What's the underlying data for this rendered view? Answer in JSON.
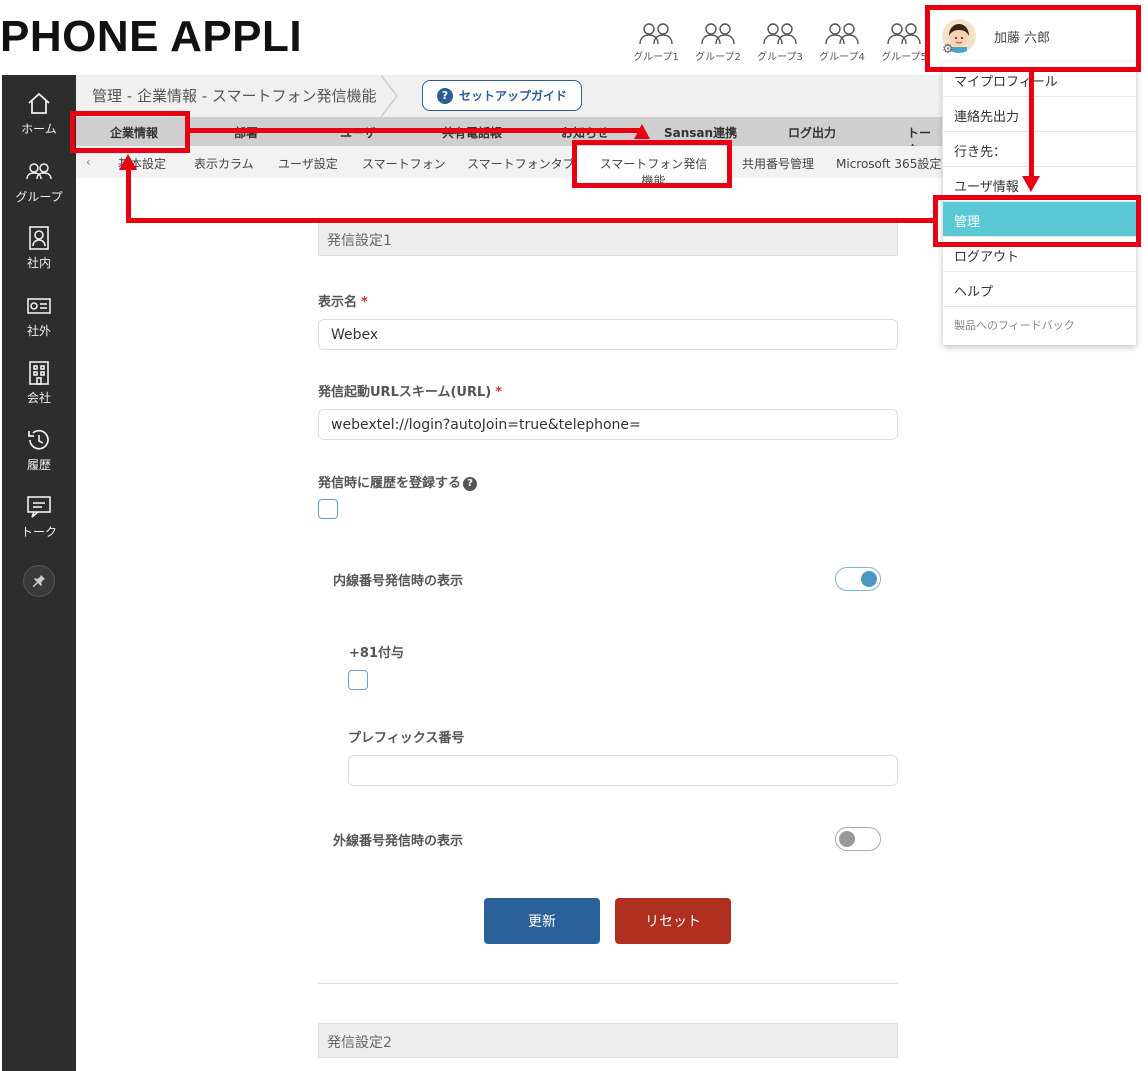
{
  "header": {
    "logo": "PHONE APPLI",
    "groups": [
      "グループ1",
      "グループ2",
      "グループ3",
      "グループ4",
      "グループ5"
    ],
    "user_name": "加藤 六郎"
  },
  "sidebar": {
    "items": [
      {
        "label": "ホーム",
        "icon": "home-icon"
      },
      {
        "label": "グループ",
        "icon": "group-icon"
      },
      {
        "label": "社内",
        "icon": "contact-card-icon"
      },
      {
        "label": "社外",
        "icon": "business-card-icon"
      },
      {
        "label": "会社",
        "icon": "building-icon"
      },
      {
        "label": "履歴",
        "icon": "history-icon"
      },
      {
        "label": "トーク",
        "icon": "chat-icon"
      }
    ]
  },
  "breadcrumb": {
    "path": "管理 - 企業情報 - スマートフォン発信機能",
    "setup_guide": "セットアップガイド"
  },
  "tabs_main": [
    "企業情報",
    "部署",
    "ユーザ",
    "共有電話帳",
    "お知らせ",
    "Sansan連携",
    "ログ出力",
    "トーク"
  ],
  "tabs_sub": [
    "基本設定",
    "表示カラム",
    "ユーザ設定",
    "スマートフォン",
    "スマートフォンタブ",
    "スマートフォン発信機能",
    "共用番号管理",
    "Microsoft 365設定"
  ],
  "tabs_sub_prev": "‹",
  "form": {
    "section1": "発信設定1",
    "display_name_label": "表示名",
    "display_name_value": "Webex",
    "url_scheme_label": "発信起動URLスキーム(URL)",
    "url_scheme_value": "webextel://login?autoJoin=true&telephone=",
    "register_history_label": "発信時に履歴を登録する",
    "register_history_checked": false,
    "internal_display_label": "内線番号発信時の表示",
    "internal_display_on": true,
    "plus81_label": "+81付与",
    "plus81_checked": false,
    "prefix_label": "プレフィックス番号",
    "prefix_value": "",
    "external_display_label": "外線番号発信時の表示",
    "external_display_on": false,
    "update_button": "更新",
    "reset_button": "リセット",
    "section2": "発信設定2",
    "required_mark": "*"
  },
  "dropdown": {
    "items": [
      "マイプロフィール",
      "連絡先出力",
      "行き先：",
      "ユーザ情報",
      "管理",
      "ログアウト",
      "ヘルプ",
      "製品へのフィードバック"
    ],
    "active": "管理"
  },
  "colors": {
    "sidebar_bg": "#2d2d2d",
    "primary_button": "#2a6099",
    "reset_button": "#b03020",
    "dropdown_active": "#5bc8d6",
    "annotation_red": "#e60012"
  }
}
